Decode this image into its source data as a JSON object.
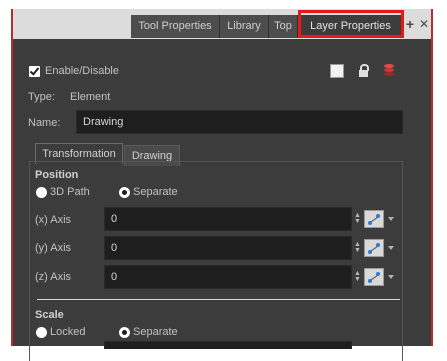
{
  "tabs": [
    {
      "label": "Tool Properties",
      "active": false
    },
    {
      "label": "Library",
      "active": false
    },
    {
      "label": "Top",
      "active": false
    },
    {
      "label": "Layer Properties",
      "active": true
    }
  ],
  "tab_icons": {
    "add": "+",
    "close": "✕"
  },
  "layer": {
    "enable_label": "Enable/Disable",
    "enabled": true,
    "type_label": "Type:",
    "type_value": "Element",
    "name_label": "Name:",
    "name_value": "Drawing"
  },
  "subtabs": [
    {
      "label": "Transformation",
      "active": true
    },
    {
      "label": "Drawing",
      "active": false
    }
  ],
  "position": {
    "title": "Position",
    "options": [
      {
        "label": "3D Path",
        "selected": false
      },
      {
        "label": "Separate",
        "selected": true
      }
    ],
    "axes": [
      {
        "label": "(x) Axis",
        "value": "0"
      },
      {
        "label": "(y) Axis",
        "value": "0"
      },
      {
        "label": "(z) Axis",
        "value": "0"
      }
    ]
  },
  "scale": {
    "title": "Scale",
    "options": [
      {
        "label": "Locked",
        "selected": false
      },
      {
        "label": "Separate",
        "selected": true
      }
    ]
  },
  "colors": {
    "panel": "#3c3c3c",
    "field": "#1e1e1e",
    "highlight": "#e41a1a",
    "frame_border": "#b32e2e"
  }
}
